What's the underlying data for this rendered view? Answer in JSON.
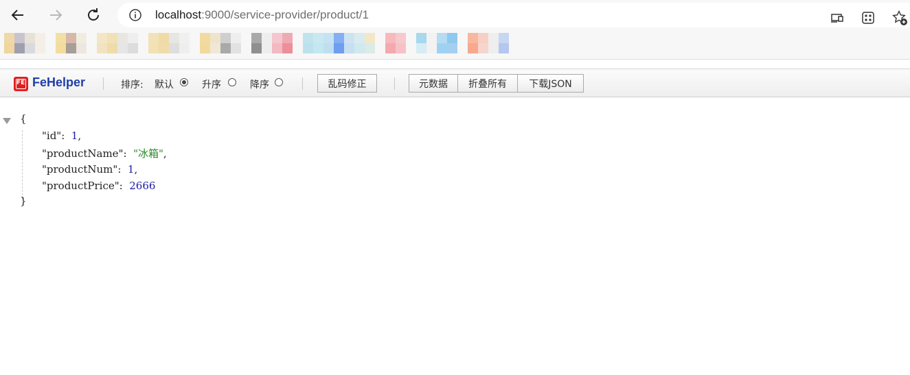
{
  "browser": {
    "url_host": "localhost",
    "url_rest": ":9000/service-provider/product/1",
    "icons": [
      "back-icon",
      "forward-icon",
      "refresh-icon",
      "info-icon",
      "cast-icon",
      "apps-icon",
      "favorite-add-icon"
    ]
  },
  "fehelper": {
    "logo_text": "FE",
    "name": "FeHelper",
    "sort_label": "排序:",
    "sort_default": "默认",
    "sort_asc": "升序",
    "sort_desc": "降序",
    "fix_encoding": "乱码修正",
    "metadata": "元数据",
    "collapse_all": "折叠所有",
    "download_json": "下载JSON"
  },
  "json_view": {
    "open_brace": "{",
    "close_brace": "}",
    "fields": [
      {
        "key": "\"id\"",
        "value": "1",
        "type": "number",
        "comma": ","
      },
      {
        "key": "\"productName\"",
        "value": "\"冰箱\"",
        "type": "string",
        "comma": ","
      },
      {
        "key": "\"productNum\"",
        "value": "1",
        "type": "number",
        "comma": ","
      },
      {
        "key": "\"productPrice\"",
        "value": "2666",
        "type": "number",
        "comma": ""
      }
    ]
  }
}
